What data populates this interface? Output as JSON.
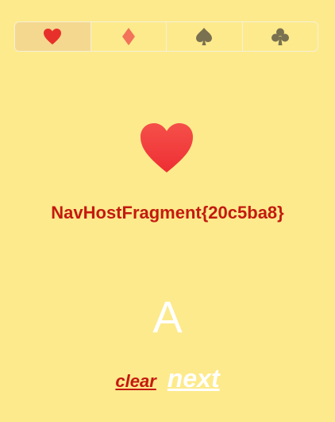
{
  "tabs": [
    {
      "icon": "heart-icon",
      "color": "#E8302A",
      "selected": true
    },
    {
      "icon": "diamond-icon",
      "color": "#F2725A",
      "selected": false
    },
    {
      "icon": "spade-icon",
      "color": "#7A7150",
      "selected": false
    },
    {
      "icon": "club-icon",
      "color": "#7A7150",
      "selected": false
    }
  ],
  "main": {
    "suit_icon": "heart-icon",
    "suit_color": "#F23A3A",
    "fragment_label": "NavHostFragment{20c5ba8}",
    "letter": "A",
    "clear_label": "clear",
    "next_label": "next"
  },
  "colors": {
    "background": "#FDEA8C",
    "accent_red": "#C41A0F",
    "selected_tab": "#F4D88F"
  }
}
